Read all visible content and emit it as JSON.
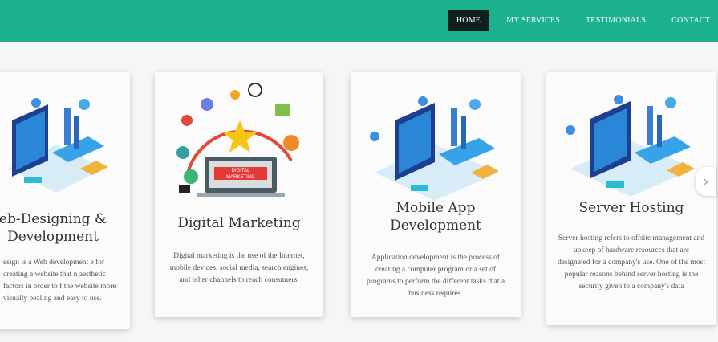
{
  "nav": {
    "items": [
      {
        "label": "HOME",
        "active": true
      },
      {
        "label": "MY SERVICES",
        "active": false
      },
      {
        "label": "TESTIMONIALS",
        "active": false
      },
      {
        "label": "CONTACT",
        "active": false
      }
    ]
  },
  "cards": [
    {
      "title_line1": "eb-Designing &",
      "title_line2": "Development",
      "desc": "esign is a Web development e for creating a website that n aesthetic factors in order to f the website more visually pealing and easy to use."
    },
    {
      "title_line1": "Digital Marketing",
      "illustration_text_1": "DIGITAL",
      "illustration_text_2": "MARKETING",
      "desc": "Digital marketing is the use of the Internet, mobile devices, social media, search engines, and other channels to reach consumers."
    },
    {
      "title_line1": "Mobile App",
      "title_line2": "Development",
      "desc": "Application development is the process of creating a computer program or a set of programs to perform the different tasks that a business requires."
    },
    {
      "title_line1": "Server Hosting",
      "desc": "Server hosting refers to offsite management and upkeep of hardware resources that are designated for a company's use. One of the most popular reasons behind server hosting is the security given to a company's data"
    }
  ],
  "carousel": {
    "next_icon": "chevron-right-icon",
    "next_glyph": "›"
  },
  "colors": {
    "header": "#1bb28d",
    "active_nav": "#0f1f1c"
  }
}
